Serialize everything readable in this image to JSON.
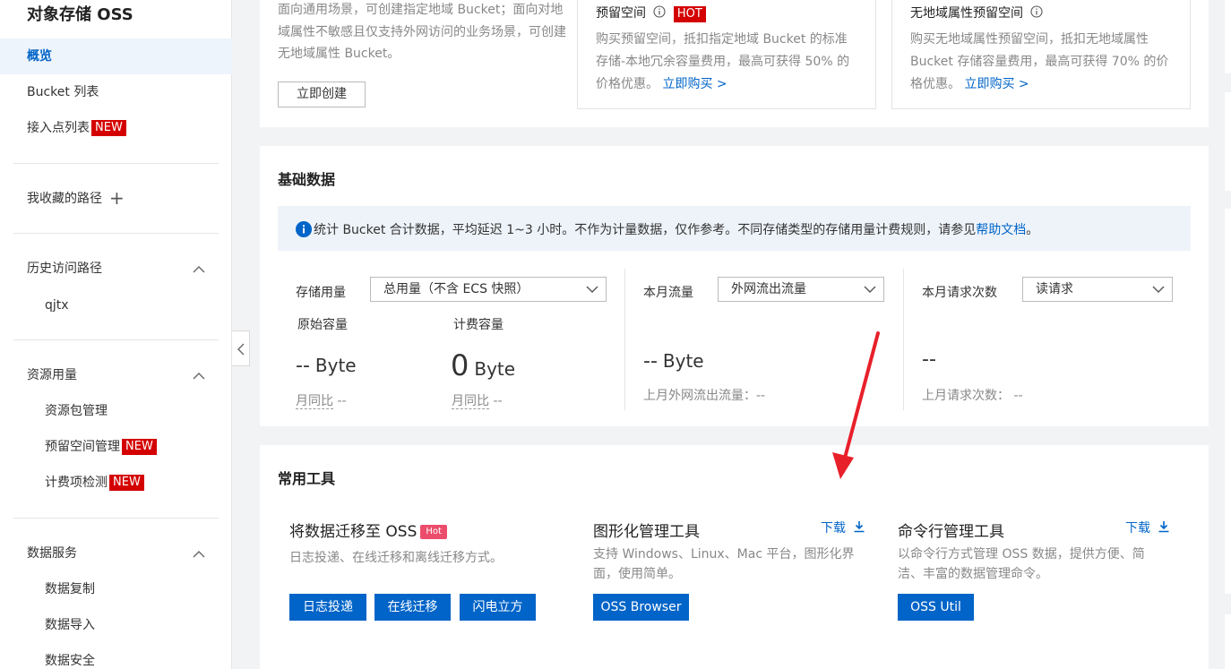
{
  "sidebar": {
    "title": "对象存储 OSS",
    "items": [
      {
        "label": "概览"
      },
      {
        "label": "Bucket 列表"
      },
      {
        "label": "接入点列表",
        "badge": "NEW"
      },
      {
        "label": "我收藏的路径"
      },
      {
        "label": "历史访问路径"
      },
      {
        "label": "qjtx"
      },
      {
        "label": "资源用量"
      },
      {
        "label": "资源包管理"
      },
      {
        "label": "预留空间管理",
        "badge": "NEW"
      },
      {
        "label": "计费项检测",
        "badge": "NEW"
      },
      {
        "label": "数据服务"
      },
      {
        "label": "数据复制"
      },
      {
        "label": "数据导入"
      },
      {
        "label": "数据安全"
      }
    ]
  },
  "top_card": {
    "left_text": "面向通用场景，可创建指定地域 Bucket；面向对地域属性不敏感且仅支持外网访问的业务场景，可创建无地域属性 Bucket。",
    "create_button": "立即创建",
    "reserved": {
      "title": "预留空间",
      "badge": "HOT",
      "desc": "购买预留空间，抵扣指定地域 Bucket 的标准存储-本地冗余容量费用，最高可获得 50% 的价格优惠。",
      "link": "立即购买 >"
    },
    "no_region": {
      "title": "无地域属性预留空间",
      "desc": "购买无地域属性预留空间，抵扣无地域属性 Bucket 存储容量费用，最高可获得 70% 的价格优惠。",
      "link": "立即购买 >"
    }
  },
  "basic_data": {
    "title": "基础数据",
    "info_text": "统计 Bucket 合计数据，平均延迟 1~3 小时。不作为计量数据，仅作参考。不同存储类型的存储用量计费规则，请参见",
    "info_link": "帮助文档",
    "info_end": "。",
    "storage": {
      "label": "存储用量",
      "select": "总用量（不含 ECS 快照）",
      "raw_label": "原始容量",
      "raw_value": "--",
      "raw_unit": "Byte",
      "bill_label": "计费容量",
      "bill_value": "0",
      "bill_unit": "Byte",
      "yoy_label": "月同比",
      "yoy_value": "--"
    },
    "traffic": {
      "label": "本月流量",
      "select": "外网流出流量",
      "value": "--",
      "unit": "Byte",
      "last_label": "上月外网流出流量：",
      "last_value": "--"
    },
    "requests": {
      "label": "本月请求次数",
      "select": "读请求",
      "value": "--",
      "last_label": "上月请求次数：",
      "last_value": "--"
    }
  },
  "tools": {
    "title": "常用工具",
    "migrate": {
      "title": "将数据迁移至 OSS",
      "badge": "Hot",
      "desc": "日志投递、在线迁移和离线迁移方式。",
      "buttons": [
        "日志投递",
        "在线迁移",
        "闪电立方"
      ]
    },
    "gui": {
      "title": "图形化管理工具",
      "download": "下载",
      "desc": "支持 Windows、Linux、Mac 平台，图形化界面，使用简单。",
      "button": "OSS Browser"
    },
    "cli": {
      "title": "命令行管理工具",
      "download": "下载",
      "desc": "以命令行方式管理 OSS 数据，提供方便、简洁、丰富的数据管理命令。",
      "button": "OSS Util"
    }
  },
  "colors": {
    "accent": "#0064c8",
    "badge_red": "#d40000",
    "hot_pink": "#ec4d6c",
    "arrow": "#e8202a"
  }
}
